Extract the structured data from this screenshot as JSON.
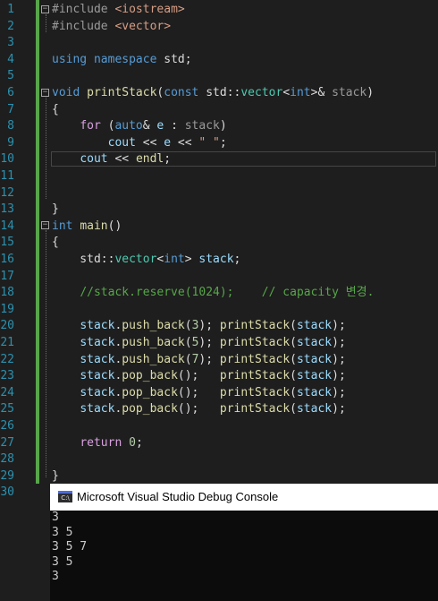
{
  "editor": {
    "line_numbers": [
      "1",
      "2",
      "3",
      "4",
      "5",
      "6",
      "7",
      "8",
      "9",
      "10",
      "11",
      "12",
      "13",
      "14",
      "15",
      "16",
      "17",
      "18",
      "19",
      "20",
      "21",
      "22",
      "23",
      "24",
      "25",
      "26",
      "27",
      "28",
      "29",
      "30"
    ],
    "lines": [
      [
        {
          "t": "#include ",
          "c": "pp"
        },
        {
          "t": "<iostream>",
          "c": "inc"
        }
      ],
      [
        {
          "t": "#include ",
          "c": "pp"
        },
        {
          "t": "<vector>",
          "c": "inc"
        }
      ],
      [],
      [
        {
          "t": "using",
          "c": "kw"
        },
        {
          "t": " "
        },
        {
          "t": "namespace",
          "c": "kw"
        },
        {
          "t": " std;"
        }
      ],
      [],
      [
        {
          "t": "void",
          "c": "kw"
        },
        {
          "t": " "
        },
        {
          "t": "printStack",
          "c": "fn"
        },
        {
          "t": "("
        },
        {
          "t": "const",
          "c": "kw"
        },
        {
          "t": " std::"
        },
        {
          "t": "vector",
          "c": "ty"
        },
        {
          "t": "<"
        },
        {
          "t": "int",
          "c": "kw"
        },
        {
          "t": ">& "
        },
        {
          "t": "stack",
          "c": "pm"
        },
        {
          "t": ")"
        }
      ],
      [
        {
          "t": "{"
        }
      ],
      [
        {
          "t": "    "
        },
        {
          "t": "for",
          "c": "kw2"
        },
        {
          "t": " ("
        },
        {
          "t": "auto",
          "c": "kw"
        },
        {
          "t": "& "
        },
        {
          "t": "e",
          "c": "id"
        },
        {
          "t": " : "
        },
        {
          "t": "stack",
          "c": "pm"
        },
        {
          "t": ")"
        }
      ],
      [
        {
          "t": "        "
        },
        {
          "t": "cout",
          "c": "id"
        },
        {
          "t": " << "
        },
        {
          "t": "e",
          "c": "id"
        },
        {
          "t": " << "
        },
        {
          "t": "\" \"",
          "c": "str"
        },
        {
          "t": ";"
        }
      ],
      [
        {
          "t": "    "
        },
        {
          "t": "cout",
          "c": "id"
        },
        {
          "t": " << "
        },
        {
          "t": "endl",
          "c": "fn"
        },
        {
          "t": ";"
        }
      ],
      [],
      [],
      [
        {
          "t": "}"
        }
      ],
      [
        {
          "t": "int",
          "c": "kw"
        },
        {
          "t": " "
        },
        {
          "t": "main",
          "c": "fn"
        },
        {
          "t": "()"
        }
      ],
      [
        {
          "t": "{"
        }
      ],
      [
        {
          "t": "    std::"
        },
        {
          "t": "vector",
          "c": "ty"
        },
        {
          "t": "<"
        },
        {
          "t": "int",
          "c": "kw"
        },
        {
          "t": "> "
        },
        {
          "t": "stack",
          "c": "id"
        },
        {
          "t": ";"
        }
      ],
      [],
      [
        {
          "t": "    "
        },
        {
          "t": "//stack.reserve(1024);    // capacity 변경.",
          "c": "cm"
        }
      ],
      [],
      [
        {
          "t": "    "
        },
        {
          "t": "stack",
          "c": "id"
        },
        {
          "t": "."
        },
        {
          "t": "push_back",
          "c": "fn"
        },
        {
          "t": "("
        },
        {
          "t": "3",
          "c": "num"
        },
        {
          "t": "); "
        },
        {
          "t": "printStack",
          "c": "fn"
        },
        {
          "t": "("
        },
        {
          "t": "stack",
          "c": "id"
        },
        {
          "t": ");"
        }
      ],
      [
        {
          "t": "    "
        },
        {
          "t": "stack",
          "c": "id"
        },
        {
          "t": "."
        },
        {
          "t": "push_back",
          "c": "fn"
        },
        {
          "t": "("
        },
        {
          "t": "5",
          "c": "num"
        },
        {
          "t": "); "
        },
        {
          "t": "printStack",
          "c": "fn"
        },
        {
          "t": "("
        },
        {
          "t": "stack",
          "c": "id"
        },
        {
          "t": ");"
        }
      ],
      [
        {
          "t": "    "
        },
        {
          "t": "stack",
          "c": "id"
        },
        {
          "t": "."
        },
        {
          "t": "push_back",
          "c": "fn"
        },
        {
          "t": "("
        },
        {
          "t": "7",
          "c": "num"
        },
        {
          "t": "); "
        },
        {
          "t": "printStack",
          "c": "fn"
        },
        {
          "t": "("
        },
        {
          "t": "stack",
          "c": "id"
        },
        {
          "t": ");"
        }
      ],
      [
        {
          "t": "    "
        },
        {
          "t": "stack",
          "c": "id"
        },
        {
          "t": "."
        },
        {
          "t": "pop_back",
          "c": "fn"
        },
        {
          "t": "();   "
        },
        {
          "t": "printStack",
          "c": "fn"
        },
        {
          "t": "("
        },
        {
          "t": "stack",
          "c": "id"
        },
        {
          "t": ");"
        }
      ],
      [
        {
          "t": "    "
        },
        {
          "t": "stack",
          "c": "id"
        },
        {
          "t": "."
        },
        {
          "t": "pop_back",
          "c": "fn"
        },
        {
          "t": "();   "
        },
        {
          "t": "printStack",
          "c": "fn"
        },
        {
          "t": "("
        },
        {
          "t": "stack",
          "c": "id"
        },
        {
          "t": ");"
        }
      ],
      [
        {
          "t": "    "
        },
        {
          "t": "stack",
          "c": "id"
        },
        {
          "t": "."
        },
        {
          "t": "pop_back",
          "c": "fn"
        },
        {
          "t": "();   "
        },
        {
          "t": "printStack",
          "c": "fn"
        },
        {
          "t": "("
        },
        {
          "t": "stack",
          "c": "id"
        },
        {
          "t": ");"
        }
      ],
      [],
      [
        {
          "t": "    "
        },
        {
          "t": "return",
          "c": "kw2"
        },
        {
          "t": " "
        },
        {
          "t": "0",
          "c": "num"
        },
        {
          "t": ";"
        }
      ],
      [],
      [
        {
          "t": "}"
        }
      ],
      []
    ]
  },
  "console": {
    "title": "Microsoft Visual Studio Debug Console",
    "icon_label": "C:\\",
    "output": [
      "3",
      "3 5",
      "3 5 7",
      "3 5",
      "3"
    ]
  },
  "colors": {
    "editor_bg": "#1e1e1e",
    "line_number": "#2b91af",
    "keyword": "#569cd6",
    "function": "#dcdcaa",
    "comment": "#57a64a",
    "change_bar": "#57a64a",
    "console_bg": "#0c0c0c"
  }
}
